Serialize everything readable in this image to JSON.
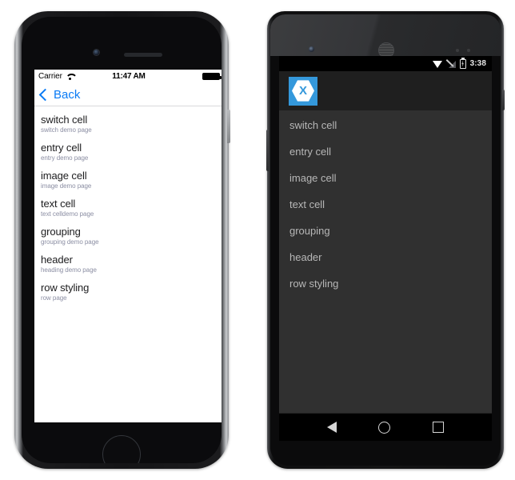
{
  "ios": {
    "status": {
      "carrier": "Carrier",
      "wifi_icon": "wifi-icon",
      "time": "11:47 AM",
      "battery_icon": "battery-full-icon"
    },
    "nav": {
      "back_label": "Back",
      "chevron_icon": "chevron-left-icon"
    },
    "cells": [
      {
        "title": "switch cell",
        "subtitle": "switch demo page"
      },
      {
        "title": "entry cell",
        "subtitle": "entry demo page"
      },
      {
        "title": "image cell",
        "subtitle": "image demo page"
      },
      {
        "title": "text cell",
        "subtitle": "text celldemo page"
      },
      {
        "title": "grouping",
        "subtitle": "grouping demo page"
      },
      {
        "title": "header",
        "subtitle": "heading demo page"
      },
      {
        "title": "row styling",
        "subtitle": "row page"
      }
    ],
    "colors": {
      "accent": "#0a7bf5",
      "title": "#1c1c1e",
      "subtitle": "#8b8ea3",
      "background": "#ffffff"
    }
  },
  "android": {
    "status": {
      "wifi_icon": "wifi-icon",
      "signal_icon": "signal-off-icon",
      "battery_icon": "battery-charging-icon",
      "time": "3:38"
    },
    "actionbar": {
      "logo_icon": "xamarin-logo-icon",
      "logo_letter": "X"
    },
    "rows": [
      {
        "label": "switch cell"
      },
      {
        "label": "entry cell"
      },
      {
        "label": "image cell"
      },
      {
        "label": "text cell"
      },
      {
        "label": "grouping"
      },
      {
        "label": "header"
      },
      {
        "label": "row styling"
      }
    ],
    "navbar": {
      "back_icon": "nav-back-icon",
      "home_icon": "nav-home-icon",
      "recents_icon": "nav-recents-icon"
    },
    "colors": {
      "accent": "#3498db",
      "actionbar": "#1f1f1f",
      "background": "#303030",
      "text": "#b7b7b7",
      "statusbar": "#000000"
    }
  }
}
